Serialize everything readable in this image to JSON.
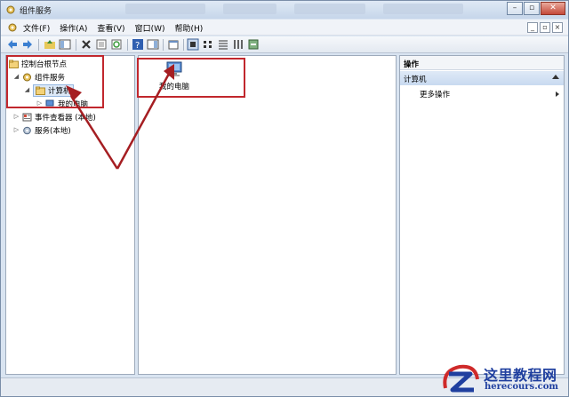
{
  "window": {
    "title": "组件服务"
  },
  "menubar": {
    "items": [
      {
        "label": "文件(F)"
      },
      {
        "label": "操作(A)"
      },
      {
        "label": "查看(V)"
      },
      {
        "label": "窗口(W)"
      },
      {
        "label": "帮助(H)"
      }
    ]
  },
  "tree": {
    "root": "控制台根节点",
    "component_services": "组件服务",
    "computers": "计算机",
    "my_computer": "我的电脑",
    "event_viewer": "事件查看器 (本地)",
    "services": "服务(本地)"
  },
  "details": {
    "item_label": "我的电脑"
  },
  "actions": {
    "header": "操作",
    "section": "计算机",
    "more": "更多操作"
  },
  "watermark": {
    "title": "这里教程网",
    "url": "herecours.com"
  },
  "colors": {
    "annotation": "#c1272d",
    "watermark": "#1f3f9f",
    "selection": "#94b6df"
  }
}
